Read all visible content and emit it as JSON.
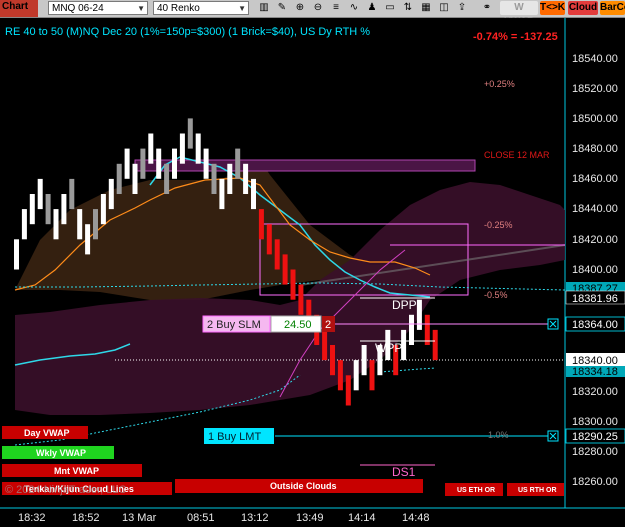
{
  "toolbar": {
    "chart_tab": "Chart",
    "instrument": "MNQ 06-24",
    "period": "40 Renko",
    "icons": [
      "bars-style-icon",
      "pencil-icon",
      "zoom-in-icon",
      "zoom-out-icon",
      "properties-icon",
      "indicators-icon",
      "strategies-icon",
      "template-icon",
      "chart-trader-icon",
      "data-box-icon",
      "screenshot-icon",
      "share-icon",
      "unlink-icon"
    ],
    "wvwap": "W VWAP",
    "tck": "T<>K",
    "cloud": "Cloud",
    "barco": "BarCo"
  },
  "header": {
    "title": "RE 40 to 50 (M)NQ Dec 20 (1%=150p=$300) (1 Brick=$40), US Dy RTH %",
    "pnl": "-0.74% = -137.25"
  },
  "levels": {
    "plus025": "+0.25%",
    "close12": "CLOSE 12 MAR",
    "minus025": "-0.25%",
    "minus05": "-0.5%",
    "one_pct": "1.0%",
    "dpp": "DPP",
    "wpp": "WPP",
    "ds1": "DS1"
  },
  "orders": {
    "buy_slm": "2 Buy SLM",
    "buy_slm_price": "24.50",
    "buy_slm_qty": "2",
    "buy_lmt": "1 Buy LMT"
  },
  "price_axis": {
    "ticks": [
      "18540.00",
      "18520.00",
      "18500.00",
      "18480.00",
      "18460.00",
      "18440.00",
      "18420.00",
      "18400.00",
      "18320.00",
      "18300.00",
      "18280.00",
      "18260.00"
    ],
    "labels": {
      "a": "18387.27",
      "b": "18381.96",
      "order1": "18364.00",
      "last": "18340.00",
      "c": "18334.18",
      "order2": "18290.25"
    }
  },
  "time_axis": [
    "18:32",
    "18:52",
    "13 Mar",
    "08:51",
    "13:12",
    "13:49",
    "14:14",
    "14:48"
  ],
  "bottom_labels": {
    "day_vwap": "Day VWAP",
    "wkly_vwap": "Wkly VWAP",
    "mnt_vwap": "Mnt VWAP",
    "clouds": "Tenkan/Kijun Cloud Lines",
    "watermark": "© 2024 NinjaTrader, LLC",
    "outside": "Outside Clouds",
    "us_eth": "US ETH OR",
    "us_rth": "US RTH OR"
  },
  "colors": {
    "up_brick": "#ffffff",
    "down_brick": "#ee1111",
    "accent_cyan": "#00e5ff",
    "order_line": "#ff88ff"
  },
  "chart_data": {
    "type": "renko",
    "brick_size": 40,
    "y_unit": "price",
    "ylim": [
      18250,
      18560
    ],
    "bricks": [
      {
        "o": 18400,
        "c": 18420
      },
      {
        "o": 18420,
        "c": 18440
      },
      {
        "o": 18430,
        "c": 18450
      },
      {
        "o": 18440,
        "c": 18460
      },
      {
        "o": 18430,
        "c": 18450
      },
      {
        "o": 18420,
        "c": 18440
      },
      {
        "o": 18430,
        "c": 18450
      },
      {
        "o": 18440,
        "c": 18460
      },
      {
        "o": 18420,
        "c": 18440
      },
      {
        "o": 18410,
        "c": 18430
      },
      {
        "o": 18420,
        "c": 18440
      },
      {
        "o": 18430,
        "c": 18450
      },
      {
        "o": 18440,
        "c": 18460
      },
      {
        "o": 18450,
        "c": 18470
      },
      {
        "o": 18460,
        "c": 18480
      },
      {
        "o": 18450,
        "c": 18470
      },
      {
        "o": 18460,
        "c": 18480
      },
      {
        "o": 18470,
        "c": 18490
      },
      {
        "o": 18460,
        "c": 18480
      },
      {
        "o": 18450,
        "c": 18470
      },
      {
        "o": 18460,
        "c": 18480
      },
      {
        "o": 18470,
        "c": 18490
      },
      {
        "o": 18480,
        "c": 18500
      },
      {
        "o": 18470,
        "c": 18490
      },
      {
        "o": 18460,
        "c": 18480
      },
      {
        "o": 18450,
        "c": 18470
      },
      {
        "o": 18440,
        "c": 18460
      },
      {
        "o": 18450,
        "c": 18470
      },
      {
        "o": 18460,
        "c": 18480
      },
      {
        "o": 18450,
        "c": 18470
      },
      {
        "o": 18440,
        "c": 18460
      },
      {
        "o": 18440,
        "c": 18420
      },
      {
        "o": 18430,
        "c": 18410
      },
      {
        "o": 18420,
        "c": 18400
      },
      {
        "o": 18410,
        "c": 18390
      },
      {
        "o": 18400,
        "c": 18380
      },
      {
        "o": 18390,
        "c": 18370
      },
      {
        "o": 18380,
        "c": 18360
      },
      {
        "o": 18370,
        "c": 18350
      },
      {
        "o": 18360,
        "c": 18340
      },
      {
        "o": 18350,
        "c": 18330
      },
      {
        "o": 18340,
        "c": 18320
      },
      {
        "o": 18330,
        "c": 18310
      },
      {
        "o": 18320,
        "c": 18340
      },
      {
        "o": 18330,
        "c": 18350
      },
      {
        "o": 18340,
        "c": 18320
      },
      {
        "o": 18330,
        "c": 18350
      },
      {
        "o": 18340,
        "c": 18360
      },
      {
        "o": 18350,
        "c": 18330
      },
      {
        "o": 18340,
        "c": 18360
      },
      {
        "o": 18350,
        "c": 18370
      },
      {
        "o": 18360,
        "c": 18380
      },
      {
        "o": 18370,
        "c": 18350
      },
      {
        "o": 18360,
        "c": 18340
      }
    ]
  }
}
